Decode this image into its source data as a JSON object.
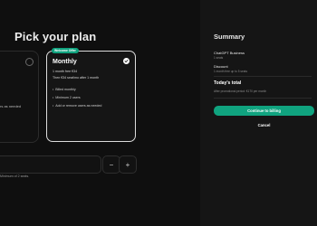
{
  "page": {
    "title": "Pick your plan"
  },
  "plans": {
    "annual": {
      "feature": "rs as needed"
    },
    "monthly": {
      "badge": "Welcome Offer",
      "name": "Monthly",
      "price_line1": "1 month free €34",
      "price_line2": "Then €34 seat/mo after 1 month",
      "features": [
        "Billed monthly",
        "Minimum 2 users",
        "Add or remove users as needed"
      ]
    }
  },
  "seats": {
    "minus_label": "−",
    "plus_label": "+",
    "note": "Minimum of 2 seats."
  },
  "summary": {
    "title": "Summary",
    "product_name": "ChatGPT Business",
    "product_seats": "1 seats",
    "discount_label": "Discount",
    "discount_detail": "1 month free up to 5 seats",
    "today_title": "Today's total",
    "today_detail": "After promotional period: €170 per month",
    "continue_label": "Continue to billing",
    "cancel_label": "Cancel"
  },
  "colors": {
    "accent": "#10a37f",
    "background": "#0f0f0f",
    "panel": "#151515"
  },
  "icons": {
    "selected": "check-icon",
    "radio": "radio-icon"
  }
}
